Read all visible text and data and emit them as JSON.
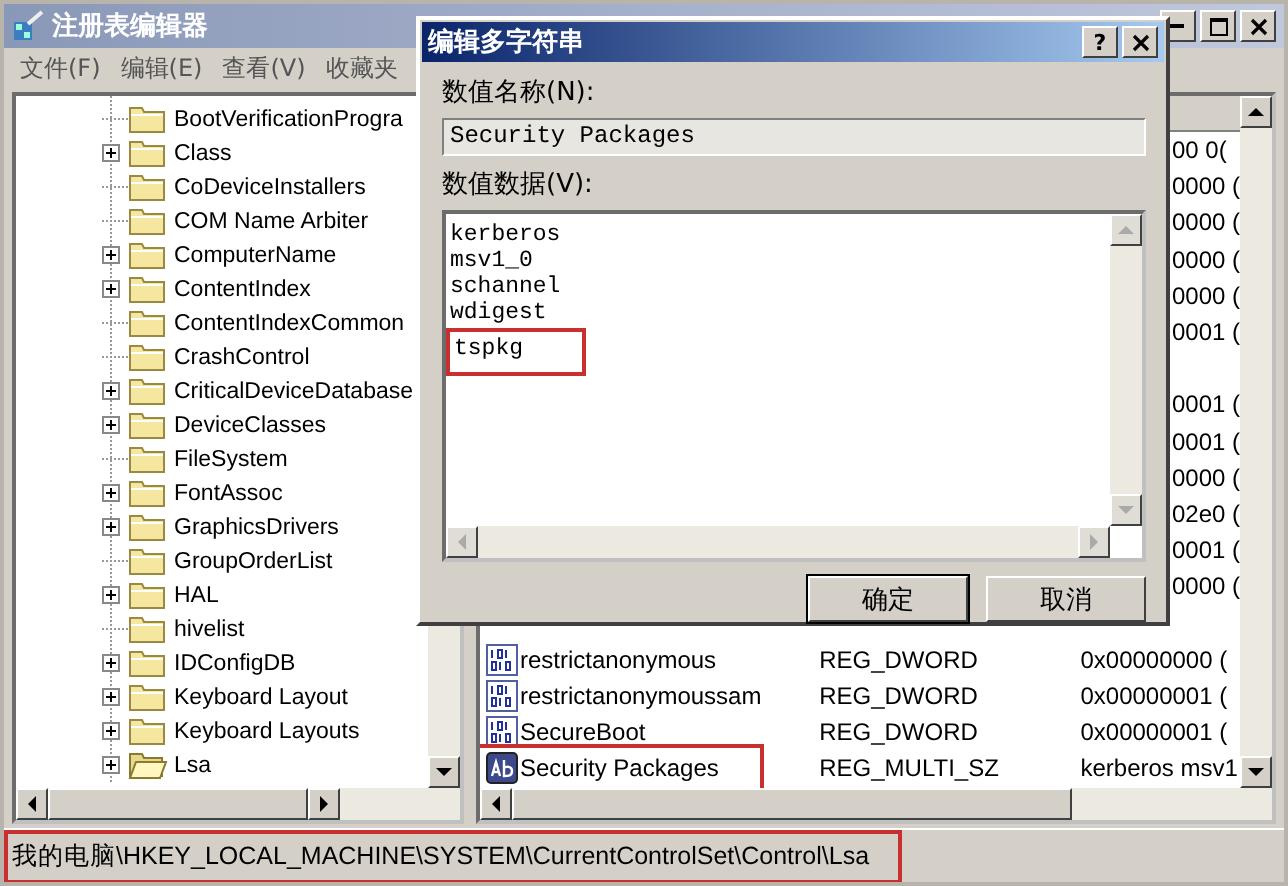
{
  "window": {
    "title": "注册表编辑器"
  },
  "menu": [
    "文件(F)",
    "编辑(E)",
    "查看(V)",
    "收藏夹"
  ],
  "tree": [
    {
      "label": "BootVerificationProgra",
      "expandable": false,
      "open": false
    },
    {
      "label": "Class",
      "expandable": true,
      "open": false
    },
    {
      "label": "CoDeviceInstallers",
      "expandable": false,
      "open": false
    },
    {
      "label": "COM Name Arbiter",
      "expandable": false,
      "open": false
    },
    {
      "label": "ComputerName",
      "expandable": true,
      "open": false
    },
    {
      "label": "ContentIndex",
      "expandable": true,
      "open": false
    },
    {
      "label": "ContentIndexCommon",
      "expandable": false,
      "open": false
    },
    {
      "label": "CrashControl",
      "expandable": false,
      "open": false
    },
    {
      "label": "CriticalDeviceDatabase",
      "expandable": true,
      "open": false
    },
    {
      "label": "DeviceClasses",
      "expandable": true,
      "open": false
    },
    {
      "label": "FileSystem",
      "expandable": false,
      "open": false
    },
    {
      "label": "FontAssoc",
      "expandable": true,
      "open": false
    },
    {
      "label": "GraphicsDrivers",
      "expandable": true,
      "open": false
    },
    {
      "label": "GroupOrderList",
      "expandable": false,
      "open": false
    },
    {
      "label": "HAL",
      "expandable": true,
      "open": false
    },
    {
      "label": "hivelist",
      "expandable": false,
      "open": false
    },
    {
      "label": "IDConfigDB",
      "expandable": true,
      "open": false
    },
    {
      "label": "Keyboard Layout",
      "expandable": true,
      "open": false
    },
    {
      "label": "Keyboard Layouts",
      "expandable": true,
      "open": false
    },
    {
      "label": "Lsa",
      "expandable": true,
      "open": true
    }
  ],
  "values": [
    {
      "kind": "partial",
      "data": "00 0("
    },
    {
      "kind": "partial",
      "data": "0000 ("
    },
    {
      "kind": "partial",
      "data": "0000 ("
    },
    {
      "kind": "partial",
      "data": "0000 ("
    },
    {
      "kind": "partial",
      "data": "0000 ("
    },
    {
      "kind": "partial",
      "data": "0001 ("
    },
    {
      "kind": "blank"
    },
    {
      "kind": "partial",
      "data": "0001 ("
    },
    {
      "kind": "partial",
      "data": "0001 ("
    },
    {
      "kind": "partial",
      "data": "0000 ("
    },
    {
      "kind": "partial",
      "data": "02e0 ("
    },
    {
      "kind": "partial",
      "data": "0001 ("
    },
    {
      "kind": "partial",
      "data": "0000 ("
    },
    {
      "kind": "blank"
    },
    {
      "kind": "dword",
      "name": "restrictanonymous",
      "type": "REG_DWORD",
      "data": "0x00000000 (",
      "highlighted": false
    },
    {
      "kind": "dword",
      "name": "restrictanonymoussam",
      "type": "REG_DWORD",
      "data": "0x00000001 (",
      "highlighted": false
    },
    {
      "kind": "dword",
      "name": "SecureBoot",
      "type": "REG_DWORD",
      "data": "0x00000001 (",
      "highlighted": false
    },
    {
      "kind": "string",
      "name": "Security Packages",
      "type": "REG_MULTI_SZ",
      "data": "kerberos msv1",
      "highlighted": true
    }
  ],
  "status_bar": {
    "path": "我的电脑\\HKEY_LOCAL_MACHINE\\SYSTEM\\CurrentControlSet\\Control\\Lsa",
    "highlighted": true
  },
  "dialog": {
    "title": "编辑多字符串",
    "help": "?",
    "name_label": "数值名称(N):",
    "name_value": "Security Packages",
    "data_label": "数值数据(V):",
    "lines": [
      {
        "text": "kerberos",
        "highlighted": false
      },
      {
        "text": "msv1_0",
        "highlighted": false
      },
      {
        "text": "schannel",
        "highlighted": false
      },
      {
        "text": "wdigest",
        "highlighted": false
      },
      {
        "text": "tspkg",
        "highlighted": true
      }
    ],
    "buttons": [
      {
        "label": "确定",
        "default": true
      },
      {
        "label": "取消",
        "default": false
      }
    ]
  }
}
